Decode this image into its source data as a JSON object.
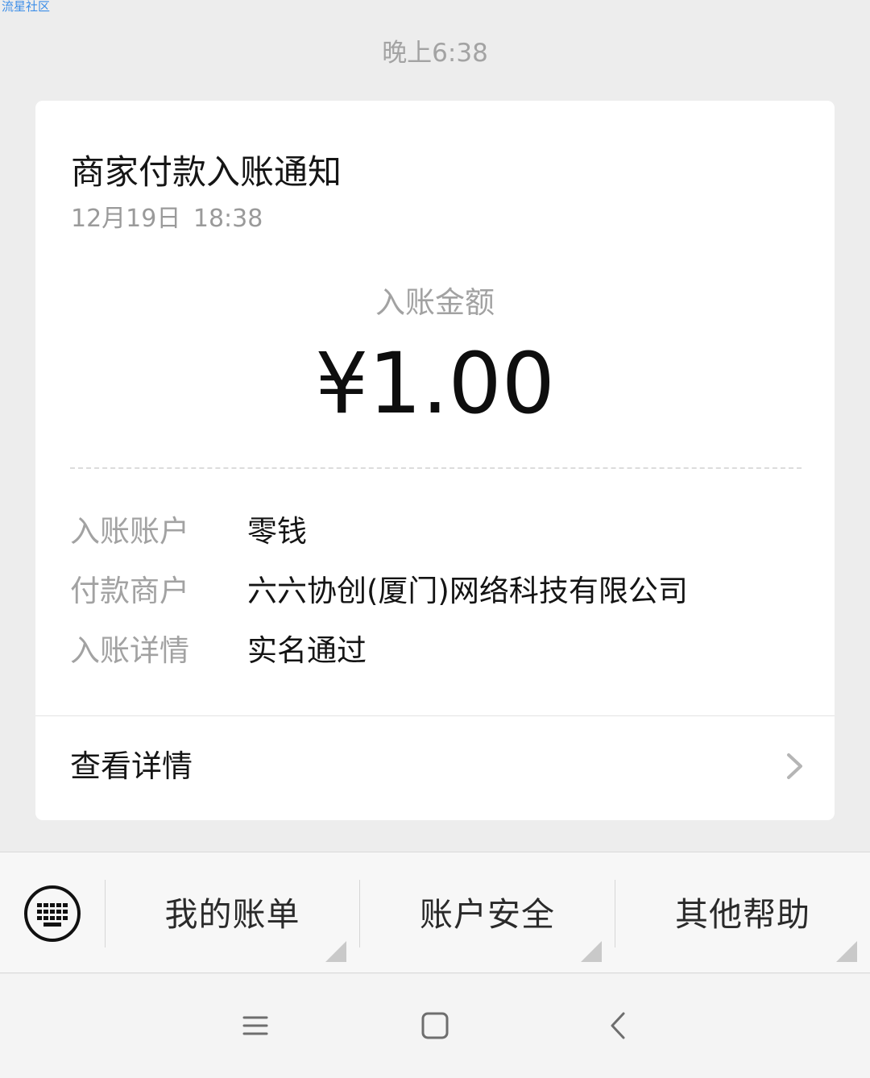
{
  "watermark": "流星社区",
  "conversation": {
    "time": "晚上6:38"
  },
  "notification": {
    "title": "商家付款入账通知",
    "date": "12月19日 18:38",
    "amount_label": "入账金额",
    "amount": "¥1.00",
    "details": [
      {
        "label": "入账账户",
        "value": "零钱"
      },
      {
        "label": "付款商户",
        "value": "六六协创(厦门)网络科技有限公司"
      },
      {
        "label": "入账详情",
        "value": "实名通过"
      }
    ],
    "view_details_label": "查看详情",
    "icons": {
      "arrow": "chevron-right-icon"
    }
  },
  "menu": {
    "keyboard_icon": "keyboard-icon",
    "items": [
      {
        "label": "我的账单"
      },
      {
        "label": "账户安全"
      },
      {
        "label": "其他帮助"
      }
    ]
  },
  "nav": {
    "icons": [
      "menu-icon",
      "home-icon",
      "back-icon"
    ]
  },
  "colors": {
    "background": "#ededed",
    "card": "#ffffff",
    "muted_text": "#a2a2a2",
    "primary_text": "#151515",
    "watermark": "#3d8ee8"
  }
}
